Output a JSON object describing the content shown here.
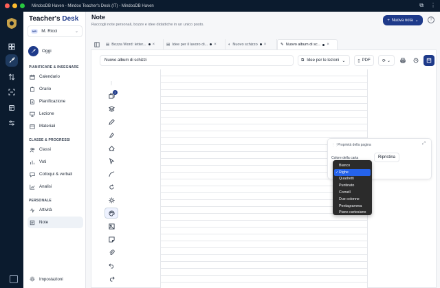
{
  "window": {
    "title": "MindooDB Haven - Mindoo Teacher's Desk (IT) - MindooDB Haven"
  },
  "brand": {
    "name_part1": "Teacher's",
    "name_part2": "Desk"
  },
  "user": {
    "initials": "MR",
    "name": "M. Ricci"
  },
  "sidebar": {
    "today": "Oggi",
    "sections": {
      "plan": "PIANIFICARE & INSEGNARE",
      "classes": "CLASSE & PROGRESSI",
      "personal": "PERSONALE"
    },
    "items": {
      "calendario": "Calendario",
      "orario": "Orario",
      "pianificazione": "Pianificazione",
      "lezione": "Lezione",
      "materiali": "Materiali",
      "classi": "Classi",
      "voti": "Voti",
      "colloqui": "Colloqui & verbali",
      "analisi": "Analisi",
      "attivita": "Attività",
      "note": "Note"
    },
    "settings": "Impostazioni"
  },
  "page": {
    "title": "Note",
    "subtitle": "Raccogli note personali, bozze e idee didattiche in un unico posto.",
    "new_note": "Nuova nota"
  },
  "tabs": [
    {
      "label": "Bozza Word: letter..."
    },
    {
      "label": "Idee per il lavoro di..."
    },
    {
      "label": "Nuovo schizzo"
    },
    {
      "label": "Nuovo album di sc..."
    }
  ],
  "editor": {
    "title_value": "Nuovo album di schizzi",
    "paper_select": "Idee per le lezioni",
    "pdf_label": "PDF",
    "layer_badge": "2"
  },
  "page_props": {
    "title": "Proprietà della pagina",
    "color_label": "Colore della carta",
    "reset": "Ripristina",
    "options": [
      "Bianco",
      "Righe",
      "Quadretti",
      "Puntinato",
      "Cornell",
      "Due colonne",
      "Pentagramma",
      "Piano cartesiano"
    ],
    "selected": "Righe"
  },
  "colors": {
    "brand": "#1e3a8a",
    "rail": "#0b1b2e",
    "selection": "#2563eb"
  }
}
